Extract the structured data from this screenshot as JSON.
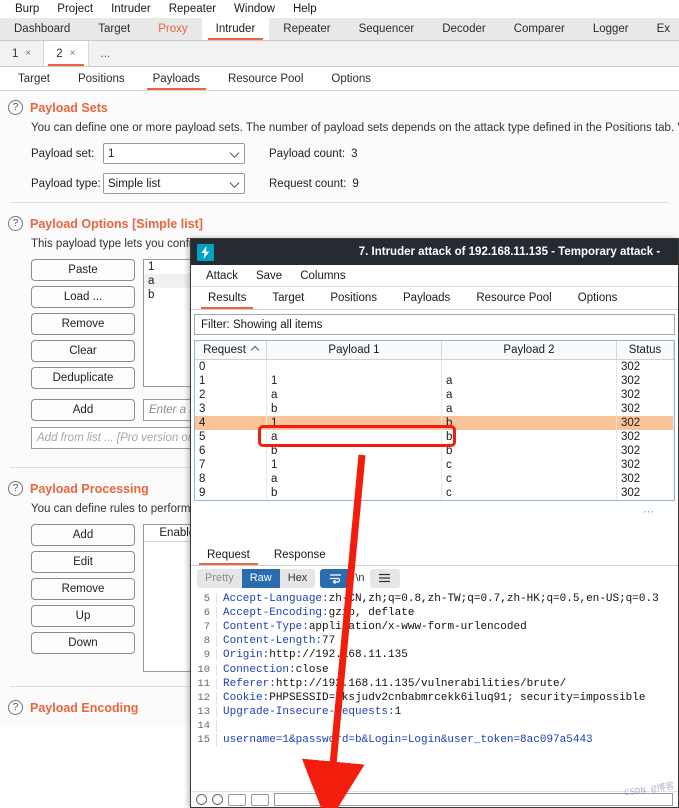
{
  "colors": {
    "accent": "#e8663d",
    "selection": "#fbc39a",
    "annotation": "#f21d0d",
    "titlebar": "#262b33",
    "logo": "#00a3bf",
    "link_key": "#1b3fbb",
    "value_red": "#a8332a"
  },
  "menubar": {
    "items": [
      "Burp",
      "Project",
      "Intruder",
      "Repeater",
      "Window",
      "Help"
    ]
  },
  "main_tabs": {
    "items": [
      {
        "label": "Dashboard",
        "state": "normal"
      },
      {
        "label": "Target",
        "state": "normal"
      },
      {
        "label": "Proxy",
        "state": "highlight"
      },
      {
        "label": "Intruder",
        "state": "active"
      },
      {
        "label": "Repeater",
        "state": "normal"
      },
      {
        "label": "Sequencer",
        "state": "normal"
      },
      {
        "label": "Decoder",
        "state": "normal"
      },
      {
        "label": "Comparer",
        "state": "normal"
      },
      {
        "label": "Logger",
        "state": "normal"
      },
      {
        "label": "Ex",
        "state": "normal"
      }
    ]
  },
  "attack_tabs": {
    "items": [
      {
        "label": "1",
        "close": "×",
        "active": false
      },
      {
        "label": "2",
        "close": "×",
        "active": true
      }
    ],
    "overflow": "..."
  },
  "sub_tabs": {
    "items": [
      "Target",
      "Positions",
      "Payloads",
      "Resource Pool",
      "Options"
    ],
    "active": "Payloads"
  },
  "payload_sets": {
    "title": "Payload Sets",
    "help_icon": "?",
    "description": "You can define one or more payload sets. The number of payload sets depends on the attack type defined in the Positions tab. Various pa",
    "payload_set_label": "Payload set:",
    "payload_set_value": "1",
    "payload_type_label": "Payload type:",
    "payload_type_value": "Simple list",
    "payload_count_label": "Payload count:",
    "payload_count_value": "3",
    "request_count_label": "Request count:",
    "request_count_value": "9"
  },
  "payload_options": {
    "title": "Payload Options [Simple list]",
    "help_icon": "?",
    "description": "This payload type lets you config",
    "buttons": [
      "Paste",
      "Load ...",
      "Remove",
      "Clear",
      "Deduplicate"
    ],
    "list_items": [
      "1",
      "a",
      "b"
    ],
    "add_button": "Add",
    "add_placeholder": "Enter a ne",
    "add_from_list": "Add from list ... [Pro version on"
  },
  "payload_processing": {
    "title": "Payload Processing",
    "help_icon": "?",
    "description": "You can define rules to perform",
    "buttons": [
      "Add",
      "Edit",
      "Remove",
      "Up",
      "Down"
    ],
    "table_header": "Enabled"
  },
  "payload_encoding": {
    "title": "Payload Encoding",
    "help_icon": "?"
  },
  "attack_window": {
    "title": "7. Intruder attack of 192.168.11.135 - Temporary attack -",
    "logo_icon": "burp-lightning-icon",
    "menu": [
      "Attack",
      "Save",
      "Columns"
    ],
    "tabs": [
      "Results",
      "Target",
      "Positions",
      "Payloads",
      "Resource Pool",
      "Options"
    ],
    "active_tab": "Results",
    "filter": "Filter: Showing all items",
    "results_table": {
      "columns": [
        "Request",
        "Payload 1",
        "Payload 2",
        "Status"
      ],
      "sort_column": "Request",
      "sort_icon": "sort-ascending-icon",
      "selected_row_index": 4,
      "rows": [
        {
          "request": "0",
          "payload1": "",
          "payload2": "",
          "status": "302"
        },
        {
          "request": "1",
          "payload1": "1",
          "payload2": "a",
          "status": "302"
        },
        {
          "request": "2",
          "payload1": "a",
          "payload2": "a",
          "status": "302"
        },
        {
          "request": "3",
          "payload1": "b",
          "payload2": "a",
          "status": "302"
        },
        {
          "request": "4",
          "payload1": "1",
          "payload2": "b",
          "status": "302"
        },
        {
          "request": "5",
          "payload1": "a",
          "payload2": "b",
          "status": "302"
        },
        {
          "request": "6",
          "payload1": "b",
          "payload2": "b",
          "status": "302"
        },
        {
          "request": "7",
          "payload1": "1",
          "payload2": "c",
          "status": "302"
        },
        {
          "request": "8",
          "payload1": "a",
          "payload2": "c",
          "status": "302"
        },
        {
          "request": "9",
          "payload1": "b",
          "payload2": "c",
          "status": "302"
        }
      ]
    },
    "reqresp": {
      "tabs": [
        "Request",
        "Response"
      ],
      "active_tab": "Request",
      "view_modes": [
        "Pretty",
        "Raw",
        "Hex"
      ],
      "active_view": "Raw",
      "wrap_icon": "line-wrap-icon",
      "newline_label": "\\n",
      "menu_icon": "hamburger-menu-icon",
      "lines": [
        {
          "num": "5",
          "key": "Accept-Language",
          "value": " zh-CN,zh;q=0.8,zh-TW;q=0.7,zh-HK;q=0.5,en-US;q=0.3"
        },
        {
          "num": "6",
          "key": "Accept-Encoding",
          "value": " gzip, deflate"
        },
        {
          "num": "7",
          "key": "Content-Type",
          "value": " application/x-www-form-urlencoded"
        },
        {
          "num": "8",
          "key": "Content-Length",
          "value": " 77"
        },
        {
          "num": "9",
          "key": "Origin",
          "value": " http://192.168.11.135"
        },
        {
          "num": "10",
          "key": "Connection",
          "value": " close"
        },
        {
          "num": "11",
          "key": "Referer",
          "value": " http://192.168.11.135/vulnerabilities/brute/"
        },
        {
          "num": "12",
          "key": "Cookie",
          "value": " PHPSESSID=7ksjudv2cnbabmrcekk6iluq91; security=impossible"
        },
        {
          "num": "13",
          "key": "Upgrade-Insecure-Requests",
          "value": " 1"
        },
        {
          "num": "14",
          "key": "",
          "value": ""
        },
        {
          "num": "15",
          "key": "",
          "value": "",
          "body": "username=1&password=b&Login=Login&user_token=8ac097a5443"
        }
      ]
    }
  },
  "annotation": {
    "highlight_row": 4,
    "arrow_label": "arrow-pointing-to-request-body"
  },
  "watermark": "CSDN @博客"
}
